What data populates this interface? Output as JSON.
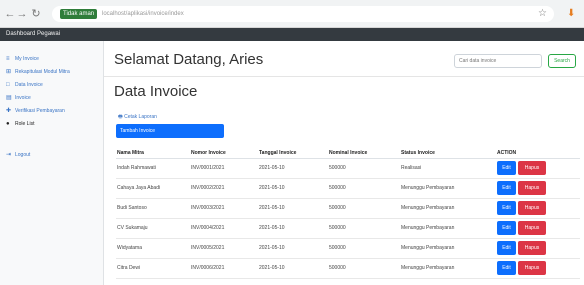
{
  "browser": {
    "back": "←",
    "forward": "→",
    "reload": "↻",
    "home": "⌂",
    "secure_label": "Tidak aman",
    "url": "localhost/aplikasi/invoice/index",
    "bookmark_icon": "star-icon",
    "download_icon": "download-icon"
  },
  "app": {
    "brand": "Dashboard Pegawai"
  },
  "sidebar": {
    "items": [
      {
        "label": "My Invoice",
        "icon": "≡"
      },
      {
        "label": "Rekapitulasi Modul Mitra",
        "icon": "⊞"
      },
      {
        "label": "Data Invoice",
        "icon": "□"
      },
      {
        "label": "Invoice",
        "icon": "▤"
      },
      {
        "label": "Verifikasi Pembayaran",
        "icon": "✚"
      },
      {
        "label": "Role List",
        "icon": "●"
      },
      {
        "label": "Logout",
        "icon": "⇥"
      }
    ]
  },
  "header": {
    "welcome": "Selamat Datang, Aries",
    "search_placeholder": "Cari data invoice",
    "search_button": "Search"
  },
  "main": {
    "title": "Data Invoice",
    "print_link": "Cetak Laporan",
    "add_button": "Tambah Invoice"
  },
  "table": {
    "headers": [
      "Nama Mitra",
      "Nomor Invoice",
      "Tanggal Invoice",
      "Nominal Invoice",
      "Status Invoice",
      "ACTION"
    ],
    "edit_label": "Edit",
    "delete_label": "Hapus",
    "rows": [
      {
        "name": "Indah Rahmawati",
        "no": "INV/0001/2021",
        "date": "2021-05-10",
        "amount": "500000",
        "status": "Realisasi"
      },
      {
        "name": "Cahaya Jaya Abadi",
        "no": "INV/0002/2021",
        "date": "2021-05-10",
        "amount": "500000",
        "status": "Menunggu Pembayaran"
      },
      {
        "name": "Budi Santoso",
        "no": "INV/0003/2021",
        "date": "2021-05-10",
        "amount": "500000",
        "status": "Menunggu Pembayaran"
      },
      {
        "name": "CV Sukamaju",
        "no": "INV/0004/2021",
        "date": "2021-05-10",
        "amount": "500000",
        "status": "Menunggu Pembayaran"
      },
      {
        "name": "Widyatama",
        "no": "INV/0005/2021",
        "date": "2021-05-10",
        "amount": "500000",
        "status": "Menunggu Pembayaran"
      },
      {
        "name": "Citra Dewi",
        "no": "INV/0006/2021",
        "date": "2021-05-10",
        "amount": "500000",
        "status": "Menunggu Pembayaran"
      }
    ]
  }
}
